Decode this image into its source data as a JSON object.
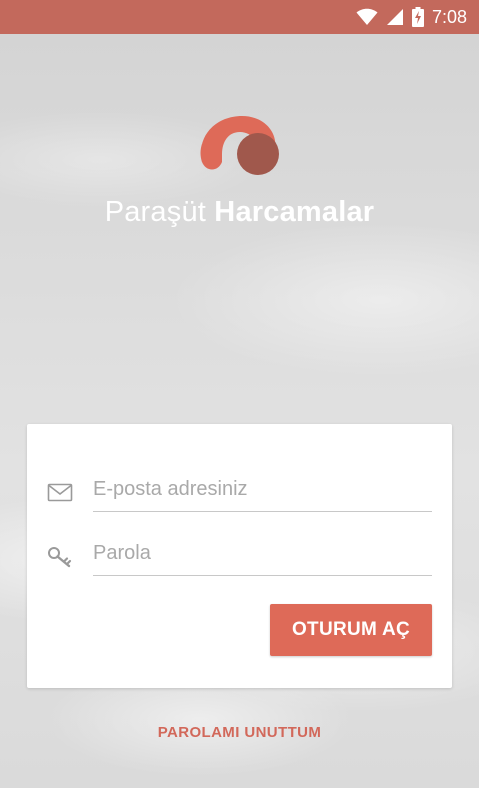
{
  "status_bar": {
    "time": "7:08",
    "icons": [
      "wifi-icon",
      "cell-signal-icon",
      "battery-charging-icon"
    ],
    "background": "#c3695c"
  },
  "brand": {
    "logo_icon": "parasut-logo-icon",
    "title_regular": "Paraşüt",
    "title_bold": "Harcamalar"
  },
  "login_form": {
    "email_placeholder": "E-posta adresiniz",
    "email_value": "",
    "email_icon": "envelope-icon",
    "password_placeholder": "Parola",
    "password_value": "",
    "password_icon": "key-icon",
    "submit_label": "OTURUM AÇ"
  },
  "forgot_password_label": "PAROLAMI UNUTTUM",
  "colors": {
    "accent": "#de6a58",
    "logo_dark": "#a0584c",
    "link": "#d2685a"
  }
}
